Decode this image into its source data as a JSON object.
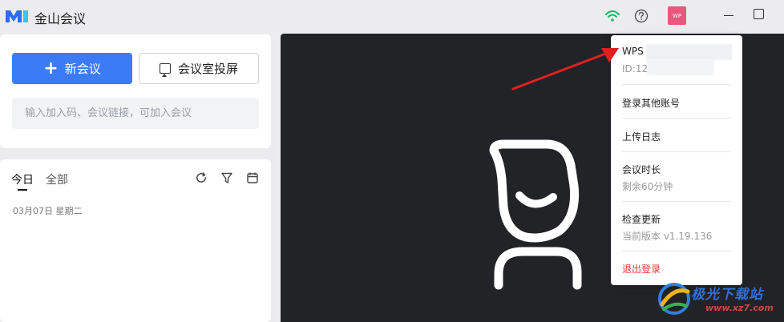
{
  "app": {
    "title": "金山会议"
  },
  "titlebar": {
    "avatar_text": "WP"
  },
  "left": {
    "new_meeting_label": "新会议",
    "cast_label": "会议室投屏",
    "join_placeholder": "输入加入码、会议链接，可加入会议",
    "tabs": [
      {
        "label": "今日"
      },
      {
        "label": "全部"
      }
    ],
    "date_label": "03月07日 星期二"
  },
  "dropdown": {
    "account_name": "WPS",
    "account_id": "ID:12",
    "switch_account": "登录其他账号",
    "upload_log": "上传日志",
    "meeting_duration": "会议时长",
    "duration_remaining": "剩余60分钟",
    "check_update": "检查更新",
    "current_version": "当前版本 v1.19.136",
    "logout": "退出登录"
  },
  "watermark": {
    "title": "极光下载站",
    "url": "www.xz7.com"
  },
  "colors": {
    "accent": "#3b7bf6",
    "avatar": "#e8577c",
    "logout": "#e5392f",
    "wifi": "#20b46a",
    "arrow": "#e02020"
  },
  "icons": [
    "app-logo-icon",
    "wifi-icon",
    "help-icon",
    "refresh-icon",
    "filter-icon",
    "calendar-icon",
    "cast-icon",
    "plus-icon"
  ]
}
